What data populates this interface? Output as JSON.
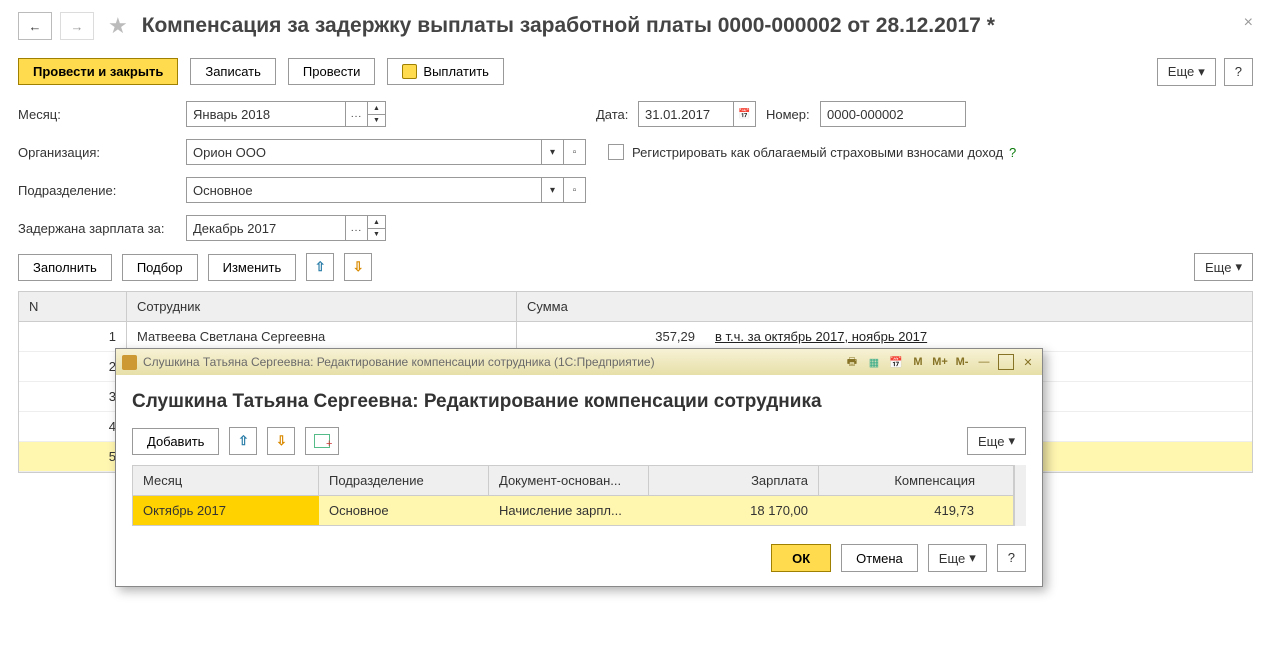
{
  "header": {
    "title": "Компенсация за задержку выплаты заработной платы 0000-000002 от 28.12.2017 *"
  },
  "toolbar": {
    "submit_close": "Провести и закрыть",
    "save": "Записать",
    "submit": "Провести",
    "pay": "Выплатить",
    "more": "Еще",
    "help": "?"
  },
  "form": {
    "month_label": "Месяц:",
    "month_value": "Январь 2018",
    "date_label": "Дата:",
    "date_value": "31.01.2017",
    "number_label": "Номер:",
    "number_value": "0000-000002",
    "org_label": "Организация:",
    "org_value": "Орион ООО",
    "reg_label": "Регистрировать как облагаемый страховыми взносами доход",
    "dept_label": "Подразделение:",
    "dept_value": "Основное",
    "delay_label": "Задержана зарплата за:",
    "delay_value": "Декабрь 2017"
  },
  "midbar": {
    "fill": "Заполнить",
    "pick": "Подбор",
    "edit": "Изменить",
    "more": "Еще"
  },
  "table": {
    "h_n": "N",
    "h_emp": "Сотрудник",
    "h_sum": "Сумма",
    "rows": [
      {
        "n": "1",
        "emp": "Матвеева Светлана Сергеевна",
        "sum": "357,29",
        "link": "в т.ч. за октябрь 2017, ноябрь 2017"
      },
      {
        "n": "2",
        "emp": "",
        "sum": "",
        "link": ""
      },
      {
        "n": "3",
        "emp": "",
        "sum": "",
        "link": ""
      },
      {
        "n": "4",
        "emp": "",
        "sum": "",
        "link": ""
      },
      {
        "n": "5",
        "emp": "",
        "sum": "",
        "link": ""
      }
    ]
  },
  "dialog": {
    "chrome_title": "Слушкина Татьяна Сергеевна: Редактирование компенсации сотрудника  (1С:Предприятие)",
    "title": "Слушкина Татьяна Сергеевна: Редактирование компенсации сотрудника",
    "add": "Добавить",
    "more": "Еще",
    "cols": {
      "c1": "Месяц",
      "c2": "Подразделение",
      "c3": "Документ-основан...",
      "c4": "Зарплата",
      "c5": "Компенсация"
    },
    "row": {
      "c1": "Октябрь 2017",
      "c2": "Основное",
      "c3": "Начисление зарпл...",
      "c4": "18 170,00",
      "c5": "419,73"
    },
    "ok": "ОК",
    "cancel": "Отмена",
    "help": "?"
  },
  "m_buttons": {
    "m": "M",
    "mp": "M+",
    "mm": "M-"
  }
}
